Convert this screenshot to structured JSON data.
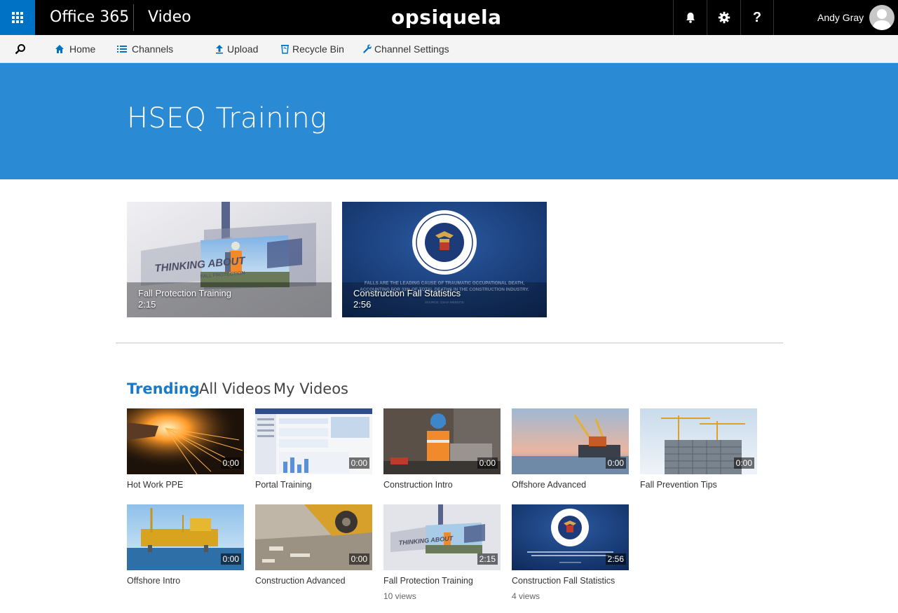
{
  "suite": {
    "brand": "Office 365",
    "app": "Video",
    "logo": "opsiquela",
    "user": "Andy Gray"
  },
  "icons": {
    "waffle": "waffle-icon",
    "bell": "bell-icon",
    "gear": "gear-icon",
    "help": "help-icon",
    "search": "search-icon",
    "home": "home-icon",
    "channels": "list-icon",
    "upload": "upload-icon",
    "recycle": "recycle-bin-icon",
    "settings": "wrench-icon"
  },
  "help_glyph": "?",
  "commands": {
    "home": "Home",
    "channels": "Channels",
    "upload": "Upload",
    "recycle": "Recycle Bin",
    "channel_settings": "Channel Settings"
  },
  "banner": {
    "title": "HSEQ Training",
    "color": "#2b8ad4"
  },
  "spotlight": [
    {
      "title": "Fall Protection Training",
      "duration": "2:15",
      "overlay_text": "THINKING ABOUT",
      "overlay_sub": "FALL PROTECTION"
    },
    {
      "title": "Construction Fall Statistics",
      "duration": "2:56",
      "overlay_text": "FALLS ARE THE LEADING CAUSE OF TRAUMATIC OCCUPATIONAL DEATH,",
      "overlay_sub": "ACCOUNTING FOR 33% OF TOTAL DEATHS IN THE CONSTRUCTION INDUSTRY.",
      "source": "SOURCE: OSHA WEBSITE"
    }
  ],
  "tabs": {
    "trending": "Trending",
    "all": "All Videos",
    "mine": "My Videos"
  },
  "videos": [
    {
      "title": "Hot Work PPE",
      "duration": "0:00",
      "views": ""
    },
    {
      "title": "Portal Training",
      "duration": "0:00",
      "views": ""
    },
    {
      "title": "Construction Intro",
      "duration": "0:00",
      "views": ""
    },
    {
      "title": "Offshore Advanced",
      "duration": "0:00",
      "views": ""
    },
    {
      "title": "Fall Prevention Tips",
      "duration": "0:00",
      "views": ""
    },
    {
      "title": "Offshore Intro",
      "duration": "0:00",
      "views": ""
    },
    {
      "title": "Construction Advanced",
      "duration": "0:00",
      "views": ""
    },
    {
      "title": "Fall Protection Training",
      "duration": "2:15",
      "views": "10 views"
    },
    {
      "title": "Construction Fall Statistics",
      "duration": "2:56",
      "views": "4 views"
    }
  ],
  "colors": {
    "accent": "#0072c6",
    "tab_active": "#1a7ac7",
    "suitebar": "#000000"
  }
}
